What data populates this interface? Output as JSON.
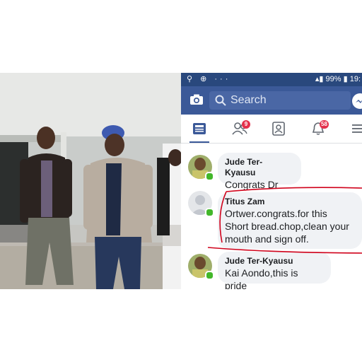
{
  "status_bar": {
    "battery": "99%",
    "time": "19:"
  },
  "search": {
    "placeholder": "Search"
  },
  "tabs": [
    {
      "icon": "news-feed-icon",
      "active": true
    },
    {
      "icon": "friend-requests-icon",
      "badge": "9"
    },
    {
      "icon": "profile-icon"
    },
    {
      "icon": "notifications-icon",
      "badge": "58"
    },
    {
      "icon": "menu-icon"
    }
  ],
  "comments": [
    {
      "author": "Jude Ter-Kyausu",
      "lines": [
        "Congrats Dr"
      ],
      "online": true
    },
    {
      "author": "Titus Zam",
      "lines": [
        "Ortwer.congrats.for this",
        "Short bread.chop,clean your",
        "mouth and sign off."
      ],
      "online": true,
      "highlighted": true
    },
    {
      "author": "Jude Ter-Kyausu",
      "lines": [
        "Kai Aondo,this is pride"
      ],
      "online": true
    }
  ],
  "colors": {
    "header": "#3b5998",
    "status": "#29487d",
    "bubble": "#f0f2f5",
    "highlight": "#d0021b",
    "online": "#42b72a",
    "badge": "#e4304b"
  }
}
